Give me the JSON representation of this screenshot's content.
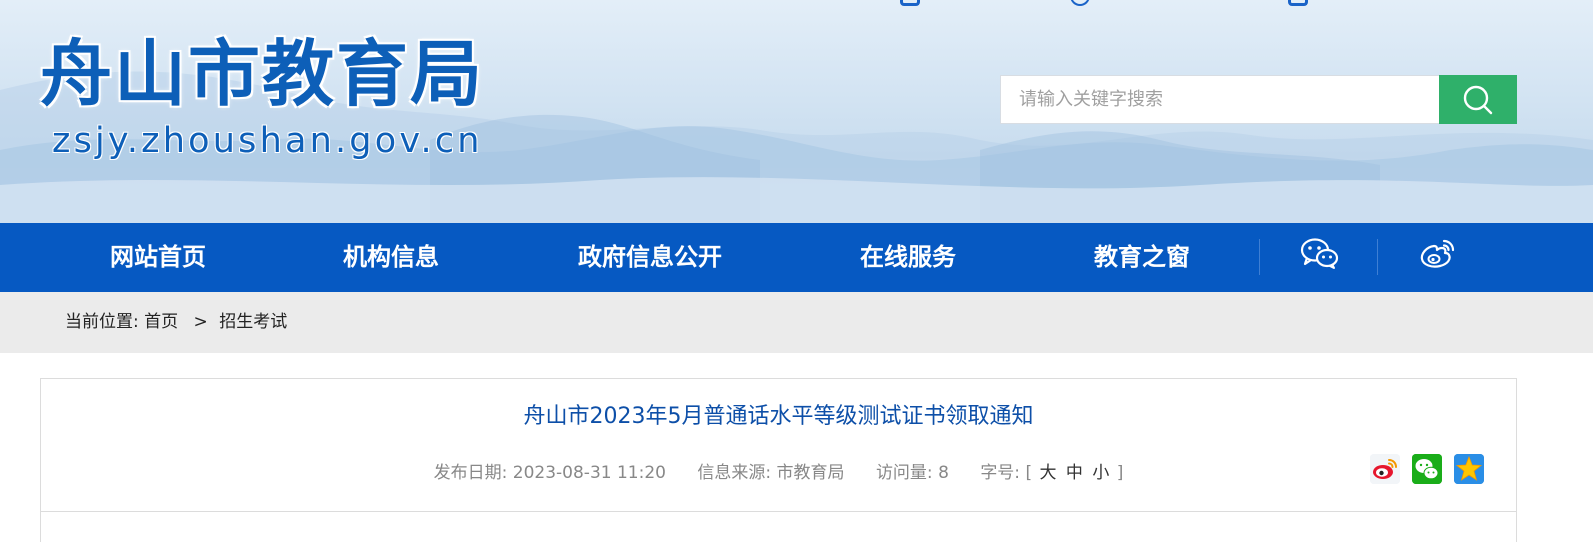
{
  "header": {
    "logo_cn": "舟山市教育局",
    "logo_url": "zsjy.zhoushan.gov.cn"
  },
  "search": {
    "placeholder": "请输入关键字搜索",
    "button_icon": "search-icon"
  },
  "nav": {
    "items": [
      {
        "label": "网站首页"
      },
      {
        "label": "机构信息"
      },
      {
        "label": "政府信息公开"
      },
      {
        "label": "在线服务"
      },
      {
        "label": "教育之窗"
      }
    ],
    "social_icons": [
      "wechat-icon",
      "weibo-icon"
    ]
  },
  "breadcrumb": {
    "prefix": "当前位置:",
    "home": "首页",
    "separator": ">",
    "current": "招生考试"
  },
  "article": {
    "title": "舟山市2023年5月普通话水平等级测试证书领取通知",
    "publish_date_label": "发布日期:",
    "publish_date": "2023-08-31 11:20",
    "source_label": "信息来源:",
    "source": "市教育局",
    "views_label": "访问量:",
    "views": "8",
    "font_size_label": "字号:",
    "font_size_open": "[",
    "font_size_large": "大",
    "font_size_medium": "中",
    "font_size_small": "小",
    "font_size_close": "]",
    "share_icons": [
      "weibo-share-icon",
      "wechat-share-icon",
      "qzone-share-icon"
    ]
  },
  "colors": {
    "nav_bg": "#0659c2",
    "search_button": "#2fb06a",
    "title_blue": "#0d4fa8",
    "breadcrumb_bg": "#ebebeb"
  }
}
